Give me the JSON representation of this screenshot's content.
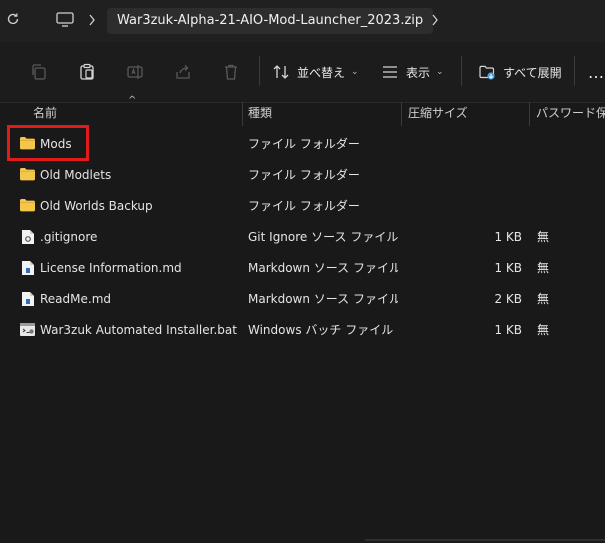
{
  "address_bar": {
    "path": "War3zuk-Alpha-21-AIO-Mod-Launcher_2023.zip"
  },
  "toolbar": {
    "sort_label": "並べ替え",
    "view_label": "表示",
    "expand_label": "すべて展開",
    "more_label": "…"
  },
  "columns": {
    "name": "名前",
    "type": "種類",
    "compressed_size": "圧縮サイズ",
    "password": "パスワード保..."
  },
  "files": [
    {
      "name": "Mods",
      "type": "ファイル フォルダー",
      "size": "",
      "password": "",
      "icon": "folder-icon"
    },
    {
      "name": "Old Modlets",
      "type": "ファイル フォルダー",
      "size": "",
      "password": "",
      "icon": "folder-icon"
    },
    {
      "name": "Old Worlds Backup",
      "type": "ファイル フォルダー",
      "size": "",
      "password": "",
      "icon": "folder-icon"
    },
    {
      "name": ".gitignore",
      "type": "Git Ignore ソース ファイル",
      "size": "1 KB",
      "password": "無",
      "icon": "gitignore-file-icon"
    },
    {
      "name": "License Information.md",
      "type": "Markdown ソース ファイル",
      "size": "1 KB",
      "password": "無",
      "icon": "markdown-file-icon"
    },
    {
      "name": "ReadMe.md",
      "type": "Markdown ソース ファイル",
      "size": "2 KB",
      "password": "無",
      "icon": "markdown-file-icon"
    },
    {
      "name": "War3zuk Automated Installer.bat",
      "type": "Windows バッチ ファイル",
      "size": "1 KB",
      "password": "無",
      "icon": "batch-file-icon"
    }
  ],
  "colors": {
    "background": "#191919",
    "highlight_box": "#e11b1b",
    "folder_yellow": "#f4c64c"
  }
}
